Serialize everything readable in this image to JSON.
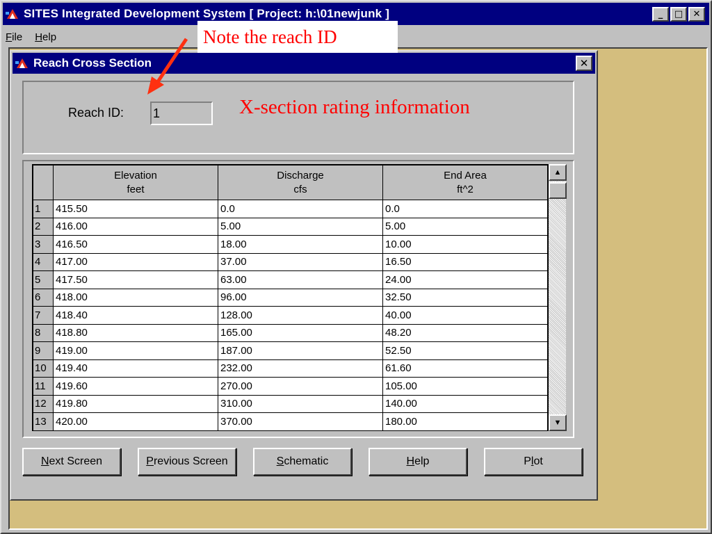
{
  "app": {
    "title": "SITES Integrated Development System [ Project: h:\\01newjunk ]",
    "menu": [
      {
        "label": "File",
        "accel": "F",
        "rest": "ile"
      },
      {
        "label": "Help",
        "accel": "H",
        "rest": "elp"
      }
    ],
    "window_buttons": {
      "minimize": "_",
      "maximize": "□",
      "close": "✕"
    }
  },
  "child": {
    "title": "Reach Cross Section",
    "close": "✕",
    "reach_label": "Reach ID:",
    "reach_value": "1"
  },
  "table": {
    "columns": [
      {
        "name": "Elevation",
        "unit": "feet"
      },
      {
        "name": "Discharge",
        "unit": "cfs"
      },
      {
        "name": "End Area",
        "unit": "ft^2"
      }
    ],
    "rows": [
      {
        "n": "1",
        "elev": "415.50",
        "q": "0.0",
        "area": "0.0"
      },
      {
        "n": "2",
        "elev": "416.00",
        "q": "5.00",
        "area": "5.00"
      },
      {
        "n": "3",
        "elev": "416.50",
        "q": "18.00",
        "area": "10.00"
      },
      {
        "n": "4",
        "elev": "417.00",
        "q": "37.00",
        "area": "16.50"
      },
      {
        "n": "5",
        "elev": "417.50",
        "q": "63.00",
        "area": "24.00"
      },
      {
        "n": "6",
        "elev": "418.00",
        "q": "96.00",
        "area": "32.50"
      },
      {
        "n": "7",
        "elev": "418.40",
        "q": "128.00",
        "area": "40.00"
      },
      {
        "n": "8",
        "elev": "418.80",
        "q": "165.00",
        "area": "48.20"
      },
      {
        "n": "9",
        "elev": "419.00",
        "q": "187.00",
        "area": "52.50"
      },
      {
        "n": "10",
        "elev": "419.40",
        "q": "232.00",
        "area": "61.60"
      },
      {
        "n": "11",
        "elev": "419.60",
        "q": "270.00",
        "area": "105.00"
      },
      {
        "n": "12",
        "elev": "419.80",
        "q": "310.00",
        "area": "140.00"
      },
      {
        "n": "13",
        "elev": "420.00",
        "q": "370.00",
        "area": "180.00"
      }
    ]
  },
  "buttons": [
    {
      "id": "next-screen-button",
      "accel": "N",
      "rest": "ext Screen"
    },
    {
      "id": "previous-screen-button",
      "accel": "P",
      "rest": "revious Screen"
    },
    {
      "id": "schematic-button",
      "accel": "S",
      "rest": "chematic"
    },
    {
      "id": "help-button",
      "accel": "H",
      "rest": "elp"
    },
    {
      "id": "plot-button",
      "pre": "P",
      "accel": "l",
      "rest": "ot"
    }
  ],
  "annotations": {
    "note": "Note the reach ID",
    "xsection": "X-section rating information",
    "color": "#ff0000"
  },
  "icons": {
    "app": "sites-app-icon",
    "scroll_up": "scroll-up-arrow-icon",
    "scroll_down": "scroll-down-arrow-icon"
  }
}
